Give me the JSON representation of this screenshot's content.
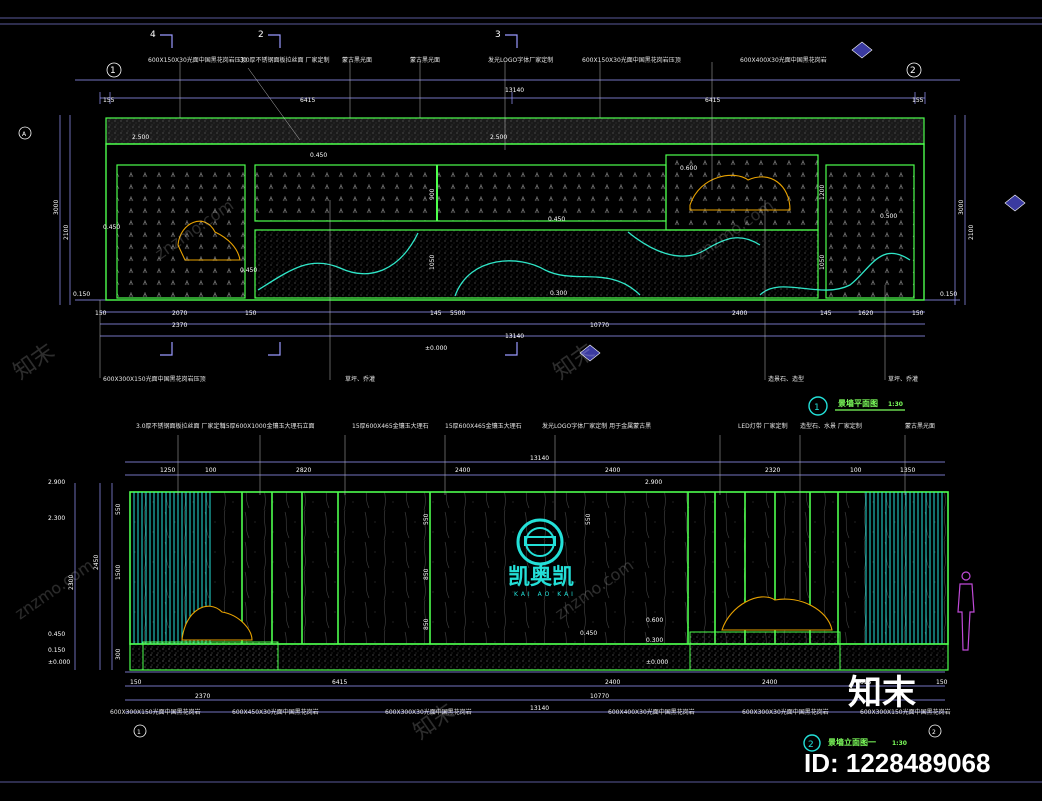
{
  "colors": {
    "background": "#000000",
    "wall_outline": "#4dff4d",
    "stripe": "#23e0d8",
    "wave": "#2fe6c8",
    "dim_line": "#9a9aff",
    "rock": "#e8a200",
    "figure": "#c04ad8",
    "text": "#ffffff"
  },
  "plan": {
    "title": "景墙平面图",
    "scale": "1:30",
    "number": "1",
    "grid_left": "1",
    "grid_right": "2",
    "grid_a": "A",
    "section_marks": [
      "4",
      "2",
      "3"
    ],
    "top_dims": [
      "155",
      "6415",
      "13140",
      "6415",
      "155"
    ],
    "bottom_dims_row1": [
      "150",
      "2070",
      "150",
      "145",
      "5500",
      "2400",
      "145",
      "1620",
      "150"
    ],
    "bottom_dims_row2": [
      "2370",
      "10770"
    ],
    "bottom_total": "13140",
    "right_dims": [
      "250",
      "150",
      "350",
      "2100",
      "150"
    ],
    "right_total": "3000",
    "left_dims": [
      "250",
      "150",
      "350",
      "2100",
      "150"
    ],
    "left_total": "3000",
    "elev_marks": [
      "2.500",
      "2.500",
      "0.450",
      "0.450",
      "0.600",
      "0.450",
      "0.500",
      "0.450",
      "0.300",
      "0.150",
      "0.150"
    ],
    "inner_dims": [
      "900",
      "50",
      "1050",
      "1200",
      "1050",
      "600"
    ],
    "ground": "±0.000",
    "top_notes": [
      "600X150X30光面中国黑花岗岩压顶",
      "3.0厚不锈钢面板拉丝面 厂家定制",
      "蒙古黑光面",
      "蒙古黑光面",
      "发光LOGO字体厂家定制",
      "600X150X30光面中国黑花岗岩压顶",
      "600X400X30光面中国黑花岗岩"
    ],
    "bottom_notes": [
      "600X300X150光面中国黑花岗岩压顶",
      "草坪、乔灌",
      "造景石、造型",
      "草坪、乔灌"
    ]
  },
  "elevation": {
    "title": "景墙立面图一",
    "scale": "1:30",
    "number": "2",
    "top_dims": [
      "1250",
      "100",
      "2820",
      "2400",
      "2400",
      "2320",
      "100",
      "1350"
    ],
    "top_total": "13140",
    "bottom_dims": [
      "150",
      "2370",
      "6415",
      "2400",
      "2400",
      "1615",
      "150"
    ],
    "bottom_row2": [
      "10770"
    ],
    "bottom_total": "13140",
    "left_elev": [
      "2.900",
      "2.300",
      "0.450",
      "0.150",
      "±0.000"
    ],
    "left_dims": [
      "2300",
      "2450",
      "550",
      "1500",
      "300",
      "150"
    ],
    "inner_elev": [
      "2.900",
      "0.600",
      "0.300",
      "0.450",
      "±0.000"
    ],
    "inner_dims": [
      "550",
      "850",
      "850",
      "550",
      "600",
      "860"
    ],
    "logo_text": "凯奥凯",
    "logo_sub": "KAI AO KAI",
    "top_notes": [
      "3.0厚不锈钢面板拉丝面 厂家定制",
      "15厚600X1000金镶玉大理石立面",
      "15厚600X465金镶玉大理石",
      "15厚600X465金镶玉大理石",
      "发光LOGO字体厂家定制 用于金属蒙古黑",
      "LED灯带 厂家定制",
      "造型石、水景 厂家定制",
      "蒙古黑光面"
    ],
    "bottom_notes": [
      "600X300X150光面中国黑花岗岩",
      "600X450X30光面中国黑花岗岩",
      "600X300X30光面中国黑花岗岩",
      "600X400X30光面中国黑花岗岩",
      "600X300X30光面中国黑花岗岩",
      "600X300X150光面中国黑花岗岩"
    ],
    "grid_left": "1",
    "grid_right": "2"
  },
  "watermark": {
    "brand": "知末",
    "site": "znzmo.com",
    "id_label": "ID: 1228489068"
  }
}
